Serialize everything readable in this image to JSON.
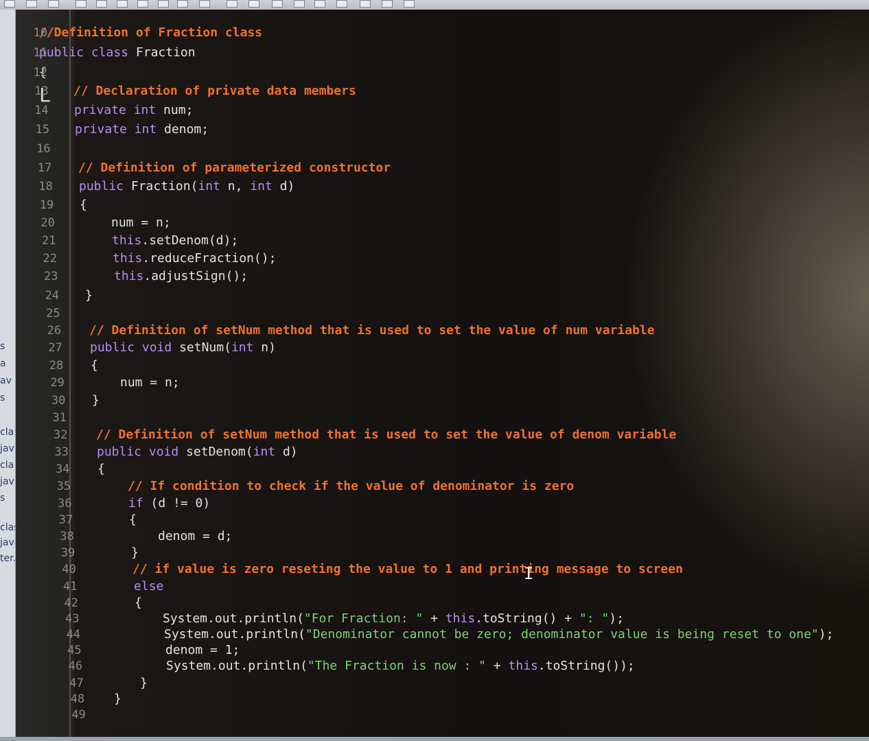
{
  "left_strip": {
    "items": [
      "s",
      "a",
      "av",
      "s",
      "cla",
      "jav",
      "cla",
      "jav",
      "s",
      "clas",
      "java",
      "ter.c"
    ]
  },
  "editor": {
    "line_numbers": [
      "10",
      "11",
      "12",
      "13",
      "14",
      "15",
      "16",
      "17",
      "18",
      "19",
      "20",
      "21",
      "22",
      "23",
      "24",
      "25",
      "26",
      "27",
      "28",
      "29",
      "30",
      "31",
      "32",
      "33",
      "34",
      "35",
      "36",
      "37",
      "38",
      "39",
      "40",
      "41",
      "42",
      "43",
      "44",
      "45",
      "46",
      "47",
      "48",
      "49"
    ],
    "lines": [
      [
        {
          "t": "//Definition of Fraction class",
          "c": "cm"
        }
      ],
      [
        {
          "t": "public",
          "c": "kw"
        },
        {
          "t": " "
        },
        {
          "t": "class",
          "c": "kw"
        },
        {
          "t": " Fraction"
        }
      ],
      [
        {
          "t": "{"
        }
      ],
      [
        {
          "t": "// Declaration of private data members",
          "c": "cm"
        }
      ],
      [
        {
          "t": "private",
          "c": "kw"
        },
        {
          "t": " "
        },
        {
          "t": "int",
          "c": "kw"
        },
        {
          "t": " num;"
        }
      ],
      [
        {
          "t": "private",
          "c": "kw"
        },
        {
          "t": " "
        },
        {
          "t": "int",
          "c": "kw"
        },
        {
          "t": " denom;"
        }
      ],
      [],
      [
        {
          "t": "// Definition of parameterized constructor",
          "c": "cm"
        }
      ],
      [
        {
          "t": "public",
          "c": "kw"
        },
        {
          "t": " Fraction("
        },
        {
          "t": "int",
          "c": "kw"
        },
        {
          "t": " n, "
        },
        {
          "t": "int",
          "c": "kw"
        },
        {
          "t": " d)"
        }
      ],
      [
        {
          "t": "{"
        }
      ],
      [
        {
          "t": "num = n;"
        }
      ],
      [
        {
          "t": "this",
          "c": "kw"
        },
        {
          "t": ".setDenom(d);"
        }
      ],
      [
        {
          "t": "this",
          "c": "kw"
        },
        {
          "t": ".reduceFraction();"
        }
      ],
      [
        {
          "t": "this",
          "c": "kw"
        },
        {
          "t": ".adjustSign();"
        }
      ],
      [
        {
          "t": "}"
        }
      ],
      [],
      [
        {
          "t": "// Definition of setNum method that is used to set the value of num variable",
          "c": "cm"
        }
      ],
      [
        {
          "t": "public",
          "c": "kw"
        },
        {
          "t": " "
        },
        {
          "t": "void",
          "c": "kw"
        },
        {
          "t": " setNum("
        },
        {
          "t": "int",
          "c": "kw"
        },
        {
          "t": " n)"
        }
      ],
      [
        {
          "t": "{"
        }
      ],
      [
        {
          "t": "num = n;"
        }
      ],
      [
        {
          "t": "}"
        }
      ],
      [],
      [
        {
          "t": "// Definition of setNum method that is used to set the value of denom variable",
          "c": "cm"
        }
      ],
      [
        {
          "t": "public",
          "c": "kw"
        },
        {
          "t": " "
        },
        {
          "t": "void",
          "c": "kw"
        },
        {
          "t": " setDenom("
        },
        {
          "t": "int",
          "c": "kw"
        },
        {
          "t": " d)"
        }
      ],
      [
        {
          "t": "{"
        }
      ],
      [
        {
          "t": "// If condition to check if the value of denominator is zero",
          "c": "cm"
        }
      ],
      [
        {
          "t": "if",
          "c": "kw"
        },
        {
          "t": " (d != 0)"
        }
      ],
      [
        {
          "t": "{"
        }
      ],
      [
        {
          "t": "denom = d;"
        }
      ],
      [
        {
          "t": "}"
        }
      ],
      [
        {
          "t": "// if value is zero reseting the value to 1 and printing message to screen",
          "c": "cm"
        }
      ],
      [
        {
          "t": "else",
          "c": "kw"
        }
      ],
      [
        {
          "t": "{"
        }
      ],
      [
        {
          "t": "System.out.println("
        },
        {
          "t": "\"For Fraction: \"",
          "c": "str"
        },
        {
          "t": " + "
        },
        {
          "t": "this",
          "c": "kw"
        },
        {
          "t": ".toString() + "
        },
        {
          "t": "\": \"",
          "c": "str"
        },
        {
          "t": ");"
        }
      ],
      [
        {
          "t": "System.out.println("
        },
        {
          "t": "\"Denominator cannot be zero; denominator value is being reset to one\"",
          "c": "str"
        },
        {
          "t": ");"
        }
      ],
      [
        {
          "t": "denom = 1;"
        }
      ],
      [
        {
          "t": "System.out.println("
        },
        {
          "t": "\"The Fraction is now : \"",
          "c": "str"
        },
        {
          "t": " + "
        },
        {
          "t": "this",
          "c": "kw"
        },
        {
          "t": ".toString());"
        }
      ],
      [
        {
          "t": "}"
        }
      ],
      [
        {
          "t": "}"
        }
      ],
      []
    ]
  }
}
